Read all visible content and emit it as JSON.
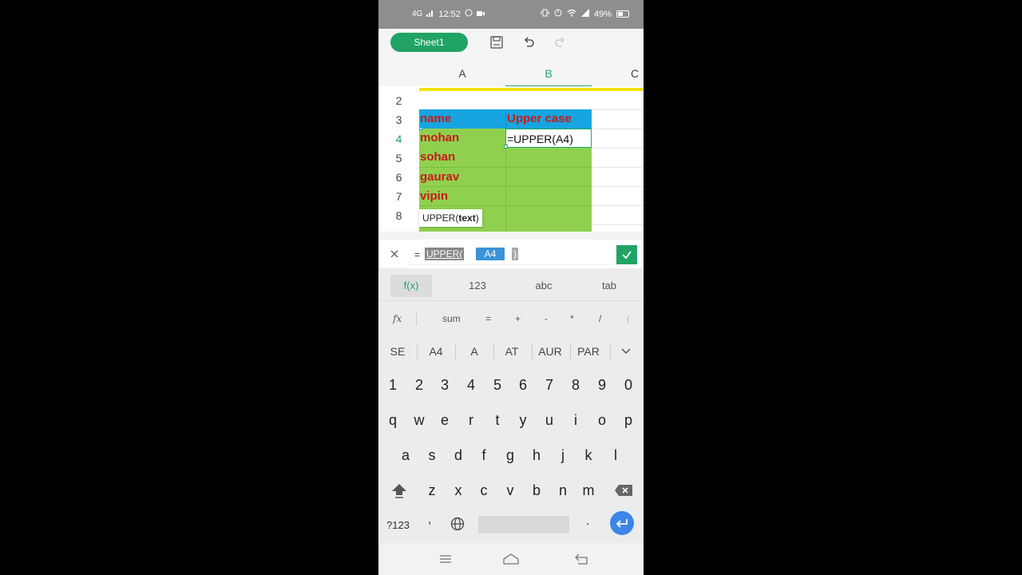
{
  "status_bar": {
    "network": "4G",
    "time": "12:52",
    "battery": "49%"
  },
  "toolbar": {
    "sheet_tab": "Sheet1",
    "icons": [
      "save-icon",
      "undo-icon",
      "redo-icon"
    ]
  },
  "grid": {
    "columns": [
      "A",
      "B",
      "C"
    ],
    "active_column": "B",
    "rows": [
      "2",
      "3",
      "4",
      "5",
      "6",
      "7",
      "8"
    ],
    "active_row": "4",
    "cells": {
      "a3": "name",
      "b3": "Upper case",
      "a4": "mohan",
      "b4": "=UPPER(A4)",
      "a5": "sohan",
      "a6": "gaurav",
      "a7": "vipin"
    },
    "tooltip": {
      "name": "UPPER(",
      "arg": "text",
      "close": ")"
    },
    "colors": {
      "header_fill": "#16a5e0",
      "data_fill": "#8fd14f",
      "text_color": "#c81919",
      "yellow_line": "#f2e20d"
    }
  },
  "formula_bar": {
    "equals": "=",
    "func": "UPPER(",
    "ref": "A4",
    "close": ")"
  },
  "keyboard": {
    "modes": [
      "f(x)",
      "123",
      "abc",
      "tab"
    ],
    "fn_row": [
      "fx",
      "sum",
      "=",
      "+",
      "-",
      "*",
      "/",
      "("
    ],
    "suggestions": [
      "SE",
      "A4",
      "A",
      "AT",
      "AUR",
      "PAR"
    ],
    "row_digits": [
      "1",
      "2",
      "3",
      "4",
      "5",
      "6",
      "7",
      "8",
      "9",
      "0"
    ],
    "row1": [
      "q",
      "w",
      "e",
      "r",
      "t",
      "y",
      "u",
      "i",
      "o",
      "p"
    ],
    "row2": [
      "a",
      "s",
      "d",
      "f",
      "g",
      "h",
      "j",
      "k",
      "l"
    ],
    "row3": [
      "z",
      "x",
      "c",
      "v",
      "b",
      "n",
      "m"
    ],
    "symbols_key": "?123",
    "comma_key": ",",
    "period_key": "."
  },
  "accent": "#21a366"
}
